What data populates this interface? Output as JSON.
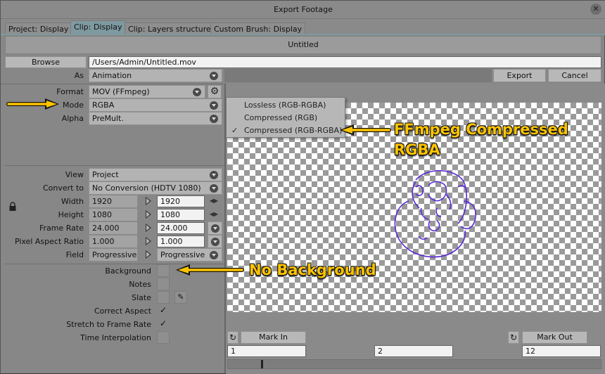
{
  "window": {
    "title": "Export Footage",
    "close_glyph": "✕"
  },
  "tabs": [
    {
      "label": "Project: Display"
    },
    {
      "label": "Clip: Display"
    },
    {
      "label": "Clip: Layers structure"
    },
    {
      "label": "Custom Brush: Display"
    }
  ],
  "header": {
    "title": "Untitled"
  },
  "browse": {
    "button": "Browse",
    "path": "/Users/Admin/Untitled.mov"
  },
  "as_row": {
    "label": "As",
    "value": "Animation"
  },
  "actions": {
    "export": "Export",
    "cancel": "Cancel"
  },
  "format": {
    "label": "Format",
    "value": "MOV (FFmpeg)"
  },
  "mode": {
    "label": "Mode",
    "value": "RGBA"
  },
  "alpha": {
    "label": "Alpha",
    "value": "PreMult."
  },
  "view": {
    "label": "View",
    "value": "Project"
  },
  "convert": {
    "label": "Convert to",
    "value": "No Conversion (HDTV 1080)"
  },
  "width": {
    "label": "Width",
    "source": "1920",
    "target": "1920"
  },
  "height": {
    "label": "Height",
    "source": "1080",
    "target": "1080"
  },
  "frame_rate": {
    "label": "Frame Rate",
    "source": "24.000",
    "target": "24.000"
  },
  "pixel_aspect": {
    "label": "Pixel Aspect Ratio",
    "source": "1.000",
    "target": "1.000"
  },
  "field": {
    "label": "Field",
    "source": "Progressive",
    "target": "Progressive"
  },
  "options": {
    "background": "Background",
    "notes": "Notes",
    "slate": "Slate",
    "correct_aspect": "Correct Aspect",
    "stretch": "Stretch to Frame Rate",
    "time_interp": "Time Interpolation",
    "checkmark": "✓"
  },
  "mode_menu": {
    "items": [
      {
        "label": "Lossless (RGB-RGBA)",
        "checked": false
      },
      {
        "label": "Compressed (RGB)",
        "checked": false
      },
      {
        "label": "Compressed (RGB-RGBA)",
        "checked": true
      }
    ],
    "check_glyph": "✓"
  },
  "timeline": {
    "mark_in": "Mark In",
    "mark_out": "Mark Out",
    "in_value": "1",
    "current_value": "2",
    "out_value": "12"
  },
  "annotations": {
    "ffmpeg_line1": "FFmpeg Compressed",
    "ffmpeg_line2": "RGBA",
    "no_background": "No Background"
  },
  "colors": {
    "annotation": "#ffc400",
    "tab_active": "#7e9aa0",
    "sketch": "#5a2bd8"
  }
}
